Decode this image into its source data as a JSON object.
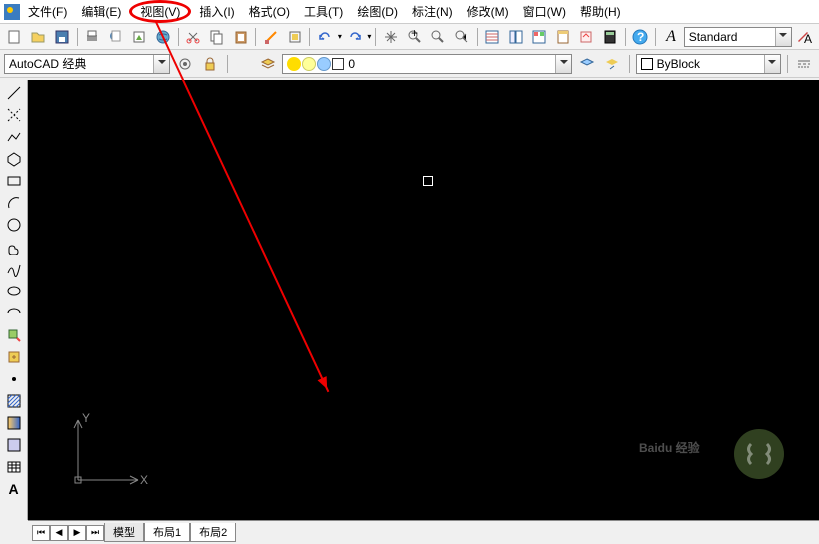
{
  "menu": {
    "items": [
      "文件(F)",
      "编辑(E)",
      "视图(V)",
      "插入(I)",
      "格式(O)",
      "工具(T)",
      "绘图(D)",
      "标注(N)",
      "修改(M)",
      "窗口(W)",
      "帮助(H)"
    ]
  },
  "row2": {
    "workspace_dd": "AutoCAD 经典",
    "layer_dd": "0",
    "color_dd": "ByBlock",
    "style_dd": "Standard"
  },
  "tabs": {
    "items": [
      "模型",
      "布局1",
      "布局2"
    ]
  },
  "ucs": {
    "x": "X",
    "y": "Y"
  },
  "watermark": "Baidu 经验"
}
